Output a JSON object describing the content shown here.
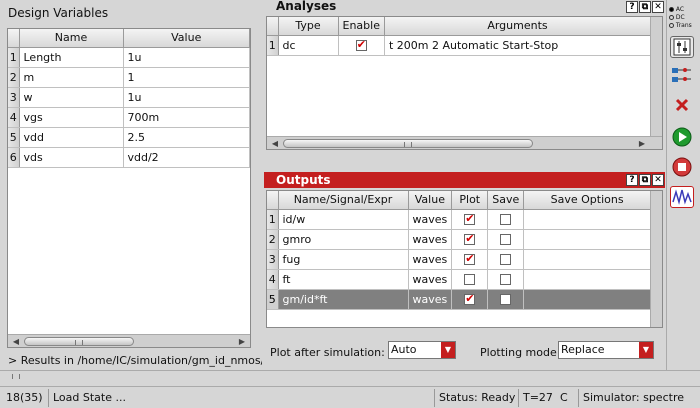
{
  "design_variables": {
    "title": "Design Variables",
    "columns": [
      "Name",
      "Value"
    ],
    "rows": [
      {
        "num": "1",
        "name": "Length",
        "value": "1u"
      },
      {
        "num": "2",
        "name": "m",
        "value": "1"
      },
      {
        "num": "3",
        "name": "w",
        "value": "1u"
      },
      {
        "num": "4",
        "name": "vgs",
        "value": "700m"
      },
      {
        "num": "5",
        "name": "vdd",
        "value": "2.5"
      },
      {
        "num": "6",
        "name": "vds",
        "value": "vdd/2"
      }
    ]
  },
  "results_path": "> Results in /home/IC/simulation/gm_id_nmos/s",
  "analyses": {
    "title": "Analyses",
    "columns": [
      "Type",
      "Enable",
      "Arguments"
    ],
    "rows": [
      {
        "num": "1",
        "type": "dc",
        "enabled": true,
        "arguments": "t 200m 2 Automatic Start-Stop"
      }
    ]
  },
  "outputs": {
    "title": "Outputs",
    "columns": [
      "Name/Signal/Expr",
      "Value",
      "Plot",
      "Save",
      "Save Options"
    ],
    "rows": [
      {
        "num": "1",
        "name": "id/w",
        "value": "waves",
        "plot": true,
        "save": false
      },
      {
        "num": "2",
        "name": "gmro",
        "value": "waves",
        "plot": true,
        "save": false
      },
      {
        "num": "3",
        "name": "fug",
        "value": "waves",
        "plot": true,
        "save": false
      },
      {
        "num": "4",
        "name": "ft",
        "value": "waves",
        "plot": false,
        "save": false
      },
      {
        "num": "5",
        "name": "gm/id*ft",
        "value": "waves",
        "plot": true,
        "save": false,
        "selected": true
      }
    ]
  },
  "controls": {
    "plot_after_label": "Plot after simulation:",
    "plot_after_value": "Auto",
    "plotting_mode_label": "Plotting mode:",
    "plotting_mode_value": "Replace"
  },
  "toolbar": {
    "radio_ac": "AC",
    "radio_dc": "DC",
    "radio_trans": "Trans"
  },
  "titlebar_buttons": {
    "help": "?",
    "float": "⧉",
    "close": "✕"
  },
  "statusbar": {
    "line_info": "18(35)",
    "message": "Load State ...",
    "status": "Status: Ready",
    "temp": "T=27",
    "temp_unit": "C",
    "simulator": "Simulator: spectre"
  },
  "colors": {
    "accent": "#c41f1f",
    "selected_row": "#808080"
  }
}
